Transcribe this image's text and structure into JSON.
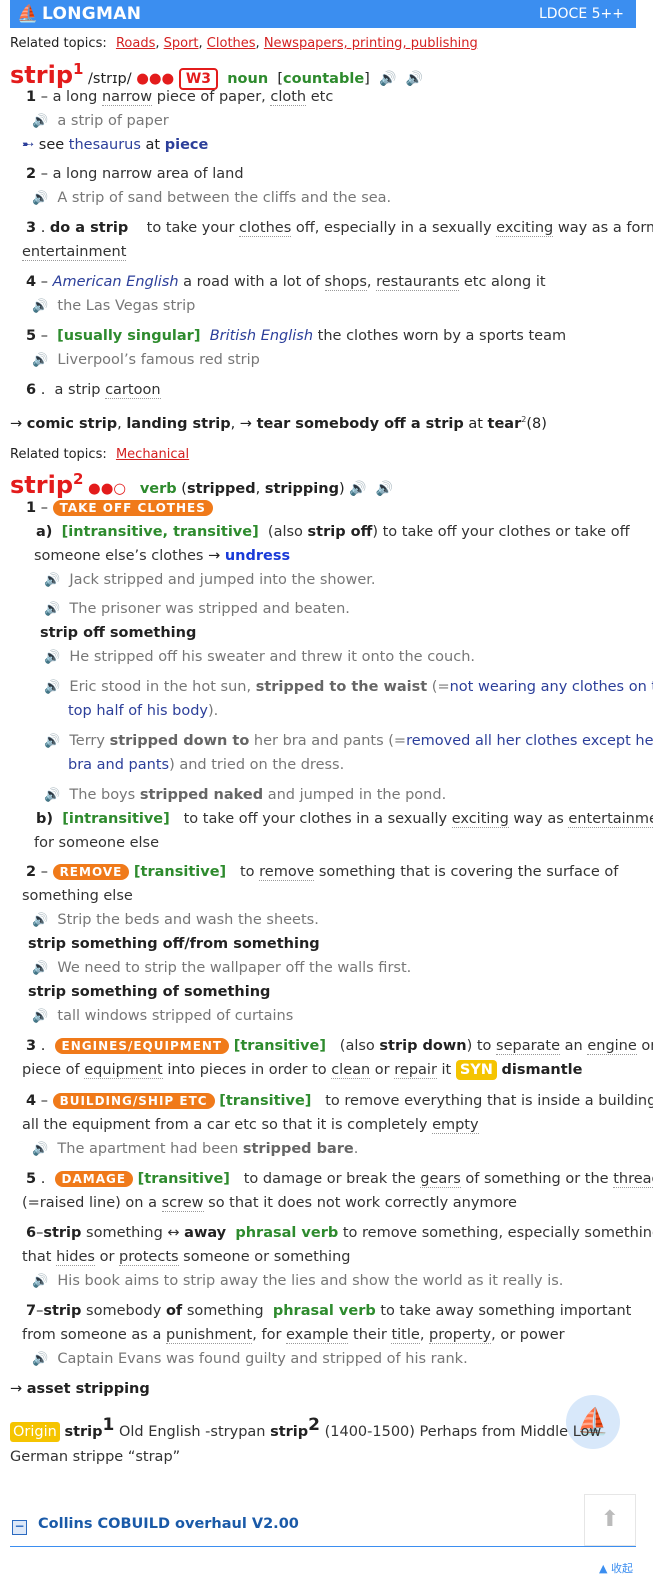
{
  "header": {
    "brand": "LONGMAN",
    "version": "LDOCE 5++"
  },
  "entry1": {
    "related_label": "Related topics:",
    "related": [
      "Roads",
      "Sport",
      "Clothes",
      "Newspapers, printing, publishing"
    ],
    "headword": "strip",
    "homnum": "1",
    "pron": "/strɪp/",
    "dots": "●●●",
    "freq": "W3",
    "pos": "noun",
    "gram": "[countable]",
    "senses": {
      "s1": {
        "num": "1",
        "def_a": "a long ",
        "def_narrow": "narrow",
        "def_b": " piece of paper, ",
        "def_cloth": "cloth",
        "def_c": " etc",
        "ex": "a strip of paper",
        "see": "see",
        "thesaurus": "thesaurus",
        "at": "at",
        "piece": "piece"
      },
      "s2": {
        "num": "2",
        "def": "a long narrow area of land",
        "ex": "A strip of sand between the cliffs and the sea."
      },
      "s3": {
        "num": "3",
        "lex": "do a strip",
        "def_a": "to take your ",
        "def_clothes": "clothes",
        "def_b": " off, especially in a sexually ",
        "def_exciting": "exciting",
        "def_c": " way as a form of",
        "def_ent": "entertainment"
      },
      "s4": {
        "num": "4",
        "reg": "American English",
        "def_a": "a road with a lot of ",
        "def_shops": "shops",
        "def_b": ", ",
        "def_rest": "restaurants",
        "def_c": " etc along it",
        "ex": "the Las Vegas strip"
      },
      "s5": {
        "num": "5",
        "gram": "[usually singular]",
        "reg": "British English",
        "def": "the clothes worn by a sports team",
        "ex": "Liverpool’s famous red strip"
      },
      "s6": {
        "num": "6",
        "def_a": "a strip ",
        "def_cartoon": "cartoon"
      }
    },
    "xref": {
      "comic": "comic strip",
      "landing": "landing strip",
      "tear": "tear somebody off a strip",
      "at": "at",
      "tear_word": "tear",
      "tear_sup": "2",
      "tear_num": "(8)"
    }
  },
  "entry2": {
    "related_label": "Related topics:",
    "related": [
      "Mechanical"
    ],
    "headword": "strip",
    "homnum": "2",
    "dots": "●●○",
    "pos": "verb",
    "forms_a": "(",
    "forms_stripped": "stripped",
    "forms_b": ", ",
    "forms_stripping": "stripping",
    "forms_c": ")",
    "s1": {
      "num": "1",
      "sig": "TAKE OFF CLOTHES",
      "a_label": "a)",
      "a_gram": "[intransitive, transitive]",
      "a_also_open": "(also ",
      "a_also": "strip off",
      "a_def": ") to take off your clothes or take off",
      "a_def2": "someone else’s clothes",
      "a_xref": "undress",
      "ex1": "Jack stripped and jumped into the shower.",
      "ex2": "The prisoner was stripped and beaten.",
      "pattern1": "strip off something",
      "ex3": "He stripped off his sweater and threw it onto the couch.",
      "ex4_a": "Eric stood in the hot sun, ",
      "ex4_b": "stripped to the waist",
      "ex4_c": " (=",
      "ex4_gloss": "not wearing any clothes on the",
      "ex4_gloss2": "top half of his body",
      "ex4_d": ").",
      "ex5_a": "Terry ",
      "ex5_b": "stripped down to",
      "ex5_c": " her bra and pants (=",
      "ex5_gloss": "removed all her clothes except her",
      "ex5_gloss2": "bra and pants",
      "ex5_d": ") and tried on the dress.",
      "ex6_a": "The boys ",
      "ex6_b": "stripped naked",
      "ex6_c": " and jumped in the pond.",
      "b_label": "b)",
      "b_gram": "[intransitive]",
      "b_def_a": "to take off your clothes in a sexually ",
      "b_exciting": "exciting",
      "b_def_b": " way as ",
      "b_ent": "entertainment",
      "b_def2": "for someone else"
    },
    "s2": {
      "num": "2",
      "sig": "REMOVE",
      "gram": "[transitive]",
      "def_a": "to ",
      "def_remove": "remove",
      "def_b": " something that is covering the surface of",
      "def2": "something else",
      "ex1": "Strip the beds and wash the sheets.",
      "pattern1": "strip something off/from something",
      "ex2": "We need to strip the wallpaper off the walls first.",
      "pattern2": "strip something of something",
      "ex3": "tall windows stripped of curtains"
    },
    "s3": {
      "num": "3",
      "sig": "ENGINES/EQUIPMENT",
      "gram": "[transitive]",
      "also_open": "(also ",
      "also": "strip down",
      "def_a": ") to ",
      "def_separate": "separate",
      "def_b": " an ",
      "def_engine": "engine",
      "def_c": " or",
      "def2_a": "piece of ",
      "def2_equip": "equipment",
      "def2_b": " into pieces in order to ",
      "def2_clean": "clean",
      "def2_c": " or ",
      "def2_repair": "repair",
      "def2_d": " it",
      "syn": "SYN",
      "syn_word": "dismantle"
    },
    "s4": {
      "num": "4",
      "sig": "BUILDING/SHIP ETC",
      "gram": "[transitive]",
      "def": "to remove everything that is inside a building,",
      "def2_a": "all the equipment from a car etc so that it is completely ",
      "def2_empty": "empty",
      "ex_a": "The apartment had been ",
      "ex_b": "stripped bare",
      "ex_c": "."
    },
    "s5": {
      "num": "5",
      "sig": "DAMAGE",
      "gram": "[transitive]",
      "def_a": "to damage or break the ",
      "def_gears": "gears",
      "def_b": " of something or the ",
      "def_thread": "thread",
      "def2_a": "(=raised line) on a ",
      "def2_screw": "screw",
      "def2_b": " so that it does not work correctly anymore"
    },
    "s6": {
      "num": "6",
      "pv_a": "strip",
      "pv_b": " something ↔ ",
      "pv_c": "away",
      "pv_tag": "phrasal verb",
      "def": "to remove something, especially something",
      "def2_a": "that ",
      "def2_hides": "hides",
      "def2_b": " or ",
      "def2_protects": "protects",
      "def2_c": " someone or something",
      "ex": "His book aims to strip away the lies and show the world as it really is."
    },
    "s7": {
      "num": "7",
      "pv_a": "strip",
      "pv_b": " somebody ",
      "pv_c": "of",
      "pv_d": " something",
      "pv_tag": "phrasal verb",
      "def": "to take away something important",
      "def2_a": "from someone as a ",
      "def2_pun": "punishment",
      "def2_b": ", for ",
      "def2_example": "example",
      "def2_c": " their ",
      "def2_title": "title",
      "def2_d": ", ",
      "def2_prop": "property",
      "def2_e": ", or power",
      "ex": "Captain Evans was found guilty and stripped of his rank."
    },
    "xref": "asset stripping"
  },
  "origin": {
    "label": "Origin",
    "w1": "strip",
    "n1": "1",
    "t1": " Old English -strypan ",
    "w2": "strip",
    "n2": "2",
    "t2": " (1400-1500) Perhaps from Middle Low",
    "t3": "German strippe “strap”"
  },
  "collins": {
    "minus": "−",
    "title": "Collins COBUILD overhaul V2.00"
  },
  "bottom_hint": "▲ 收起"
}
